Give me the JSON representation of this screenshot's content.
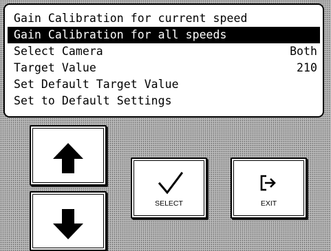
{
  "menu": {
    "items": [
      {
        "label": "Gain Calibration for current speed",
        "value": ""
      },
      {
        "label": "Gain Calibration for all speeds",
        "value": ""
      },
      {
        "label": "Select Camera",
        "value": "Both"
      },
      {
        "label": "Target Value",
        "value": "210"
      },
      {
        "label": "Set Default Target Value",
        "value": ""
      },
      {
        "label": "Set to Default Settings",
        "value": ""
      }
    ],
    "selected_index": 1
  },
  "buttons": {
    "up": {
      "icon": "arrow-up-icon"
    },
    "down": {
      "icon": "arrow-down-icon"
    },
    "select": {
      "label": "SELECT",
      "icon": "checkmark-icon"
    },
    "exit": {
      "label": "EXIT",
      "icon": "exit-icon"
    }
  }
}
